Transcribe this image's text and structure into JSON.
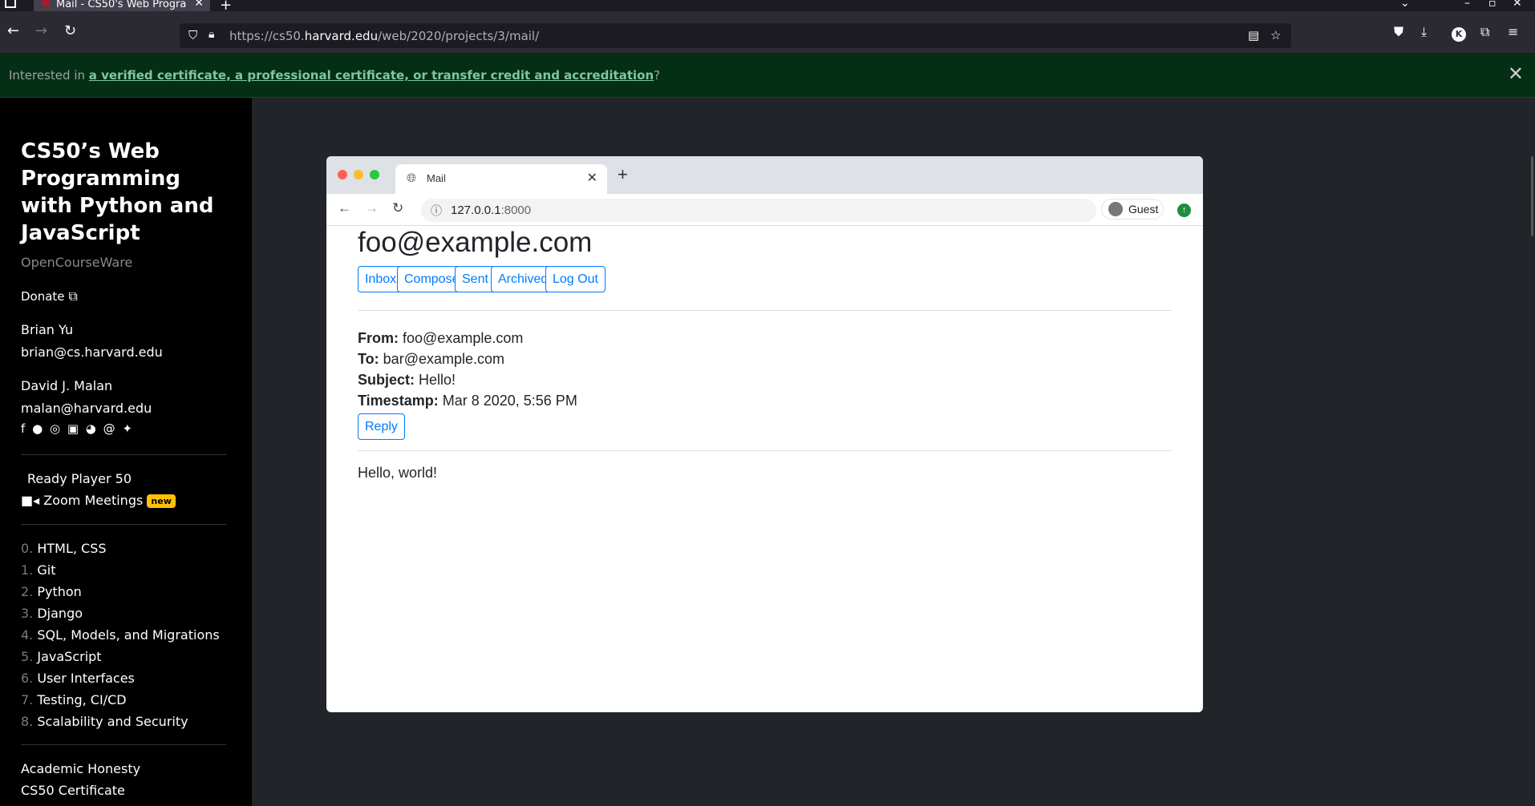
{
  "outer_browser": {
    "tab_title": "Mail - CS50's Web Progra",
    "url_prefix": "https://cs50.",
    "url_domain": "harvard.edu",
    "url_path": "/web/2020/projects/3/mail/",
    "avatar_letter": "K"
  },
  "banner": {
    "prefix": "Interested in ",
    "link": "a verified certificate, a professional certificate, or transfer credit and accreditation",
    "suffix": "?"
  },
  "sidebar": {
    "title": "CS50’s Web Programming with Python and JavaScript",
    "subtitle": "OpenCourseWare",
    "donate": "Donate",
    "instructors": [
      {
        "name": "Brian Yu",
        "email": "brian@cs.harvard.edu"
      },
      {
        "name": "David J. Malan",
        "email": "malan@harvard.edu"
      }
    ],
    "ready_player": "Ready Player 50",
    "zoom": "Zoom Meetings",
    "new_badge": "new",
    "lectures": [
      {
        "num": "0.",
        "title": "HTML, CSS"
      },
      {
        "num": "1.",
        "title": "Git"
      },
      {
        "num": "2.",
        "title": "Python"
      },
      {
        "num": "3.",
        "title": "Django"
      },
      {
        "num": "4.",
        "title": "SQL, Models, and Migrations"
      },
      {
        "num": "5.",
        "title": "JavaScript"
      },
      {
        "num": "6.",
        "title": "User Interfaces"
      },
      {
        "num": "7.",
        "title": "Testing, CI/CD"
      },
      {
        "num": "8.",
        "title": "Scalability and Security"
      }
    ],
    "academic_honesty": "Academic Honesty",
    "certificate": "CS50 Certificate"
  },
  "inner_browser": {
    "tab_title": "Mail",
    "url_host": "127.0.0.1",
    "url_port": ":8000",
    "profile": "Guest"
  },
  "mail": {
    "user": "foo@example.com",
    "nav": [
      "Inbox",
      "Compose",
      "Sent",
      "Archived",
      "Log Out"
    ],
    "from_label": "From:",
    "from": "foo@example.com",
    "to_label": "To:",
    "to": "bar@example.com",
    "subject_label": "Subject:",
    "subject": "Hello!",
    "timestamp_label": "Timestamp:",
    "timestamp": "Mar 8 2020, 5:56 PM",
    "reply": "Reply",
    "body": "Hello, world!"
  }
}
